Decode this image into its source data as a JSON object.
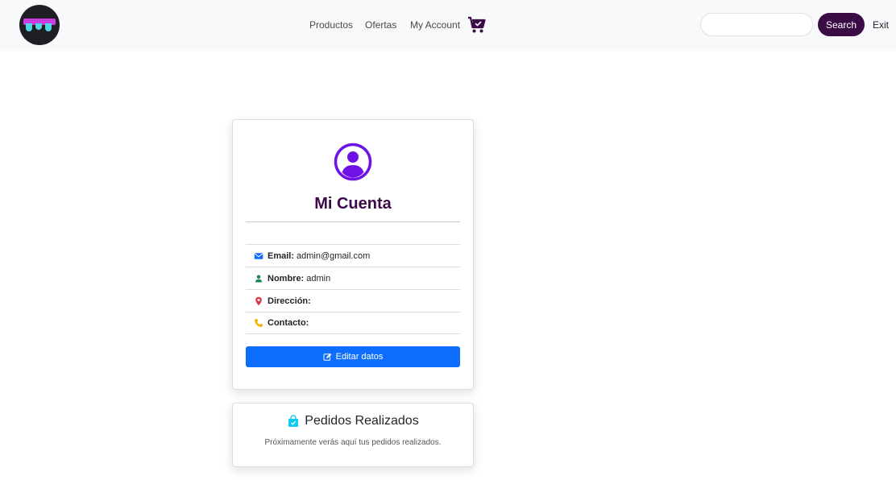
{
  "navbar": {
    "links": [
      "Productos",
      "Ofertas",
      "My Account"
    ],
    "search_placeholder": "",
    "search_label": "Search",
    "exit_label": "Exit"
  },
  "account": {
    "title": "Mi Cuenta",
    "fields": [
      {
        "icon": "envelope-icon",
        "label": "Email:",
        "value": "admin@gmail.com"
      },
      {
        "icon": "person-icon",
        "label": "Nombre:",
        "value": "admin"
      },
      {
        "icon": "location-pin-icon",
        "label": "Dirección:",
        "value": ""
      },
      {
        "icon": "phone-icon",
        "label": "Contacto:",
        "value": ""
      }
    ],
    "edit_label": "Editar datos"
  },
  "orders": {
    "title": "Pedidos Realizados",
    "message": "Próximamente verás aquí tus pedidos realizados."
  },
  "colors": {
    "brand": "#3a0b45",
    "accent_purple": "#6f12e8",
    "primary_button": "#0d6efd"
  }
}
